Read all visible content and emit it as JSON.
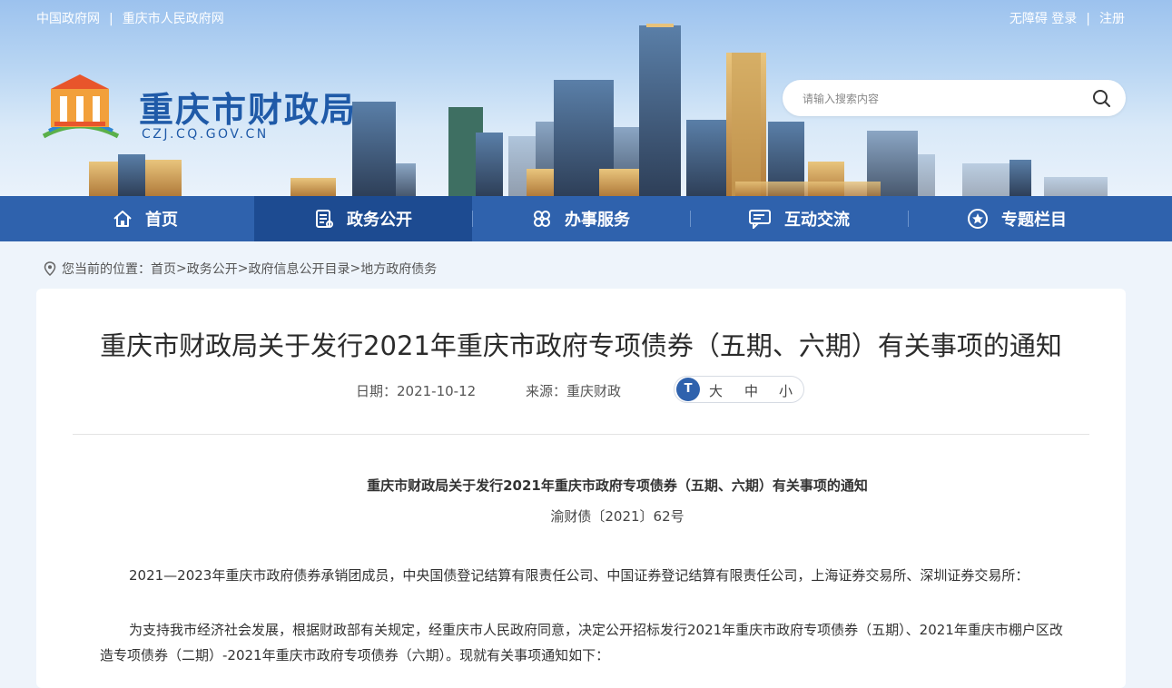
{
  "topbar": {
    "left_links": [
      "中国政府网",
      "重庆市人民政府网"
    ],
    "right_links": [
      "无障碍",
      "登录",
      "注册"
    ],
    "separator": "|"
  },
  "site": {
    "name": "重庆市财政局",
    "domain": "CZJ.CQ.GOV.CN"
  },
  "search": {
    "placeholder": "请输入搜索内容",
    "icon": "search-icon"
  },
  "nav": {
    "items": [
      {
        "label": "首页",
        "icon": "home-icon"
      },
      {
        "label": "政务公开",
        "icon": "document-icon",
        "active": true
      },
      {
        "label": "办事服务",
        "icon": "services-icon"
      },
      {
        "label": "互动交流",
        "icon": "chat-icon"
      },
      {
        "label": "专题栏目",
        "icon": "star-icon"
      }
    ]
  },
  "breadcrumb": {
    "prefix": "您当前的位置：",
    "items": [
      "首页",
      "政务公开",
      "政府信息公开目录",
      "地方政府债务"
    ],
    "separator": ">"
  },
  "article": {
    "title": "重庆市财政局关于发行2021年重庆市政府专项债券（五期、六期）有关事项的通知",
    "date": "日期：2021-10-12",
    "source": "来源：重庆财政",
    "font_sizes": [
      "大",
      "中",
      "小"
    ],
    "font_icon": "T",
    "doc_title": "重庆市财政局关于发行2021年重庆市政府专项债券（五期、六期）有关事项的通知",
    "doc_no": "渝财债〔2021〕62号",
    "paragraphs": [
      "2021—2023年重庆市政府债券承销团成员，中央国债登记结算有限责任公司、中国证券登记结算有限责任公司，上海证券交易所、深圳证券交易所：",
      "为支持我市经济社会发展，根据财政部有关规定，经重庆市人民政府同意，决定公开招标发行2021年重庆市政府专项债券（五期）、2021年重庆市棚户区改造专项债券（二期）-2021年重庆市政府专项债券（六期）。现就有关事项通知如下："
    ]
  },
  "colors": {
    "nav_bg": "#2f62ad",
    "nav_active": "#1d4b91",
    "brand_text": "#1f5aa8",
    "page_bg": "#eef4fb"
  }
}
